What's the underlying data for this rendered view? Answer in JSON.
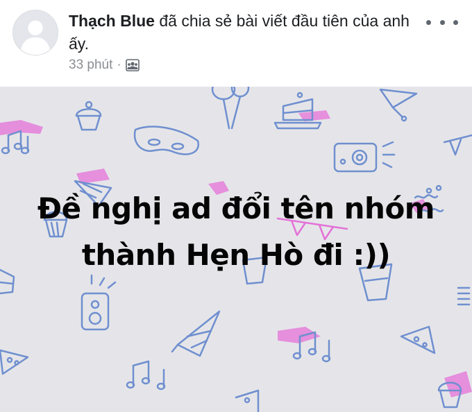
{
  "post": {
    "author": "Thạch Blue",
    "action_text": " đã chia sẻ bài viết đầu tiên của anh ấy.",
    "time": "33 phút",
    "separator": "·",
    "audience_icon": "group-audience-icon",
    "more_icon": "more-options-icon",
    "banner_text": "Đề nghị ad đổi tên nhóm thành Hẹn Hò đi :))",
    "banner_background_color": "#e5e5e9",
    "pattern_colors": {
      "blue": "#6f8fcf",
      "pink": "#e472d8"
    }
  }
}
